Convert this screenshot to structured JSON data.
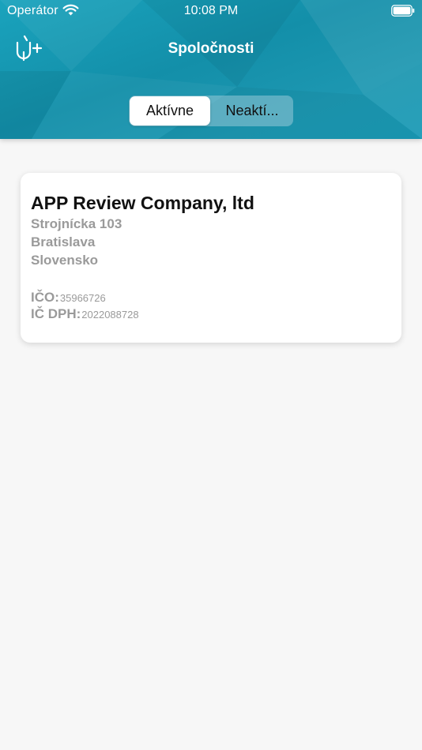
{
  "status_bar": {
    "carrier": "Operátor",
    "time": "10:08 PM",
    "wifi_icon": "wifi-icon",
    "battery_icon": "battery-full-icon"
  },
  "nav": {
    "title": "Spoločnosti",
    "add_icon": "add-company-icon"
  },
  "segmented_control": {
    "segments": [
      {
        "label": "Aktívne",
        "selected": true
      },
      {
        "label": "Neaktí...",
        "selected": false
      }
    ]
  },
  "companies": [
    {
      "name": "APP Review Company, ltd",
      "street": "Strojnícka 103",
      "city": "Bratislava",
      "country": "Slovensko",
      "ico_label": "IČO:",
      "ico_value": "35966726",
      "dic_label": "IČ DPH:",
      "dic_value": "2022088728"
    }
  ],
  "colors": {
    "header_teal": "#1697b1",
    "background": "#f7f7f7",
    "card": "#ffffff",
    "secondary_text": "#9a9a9a"
  }
}
